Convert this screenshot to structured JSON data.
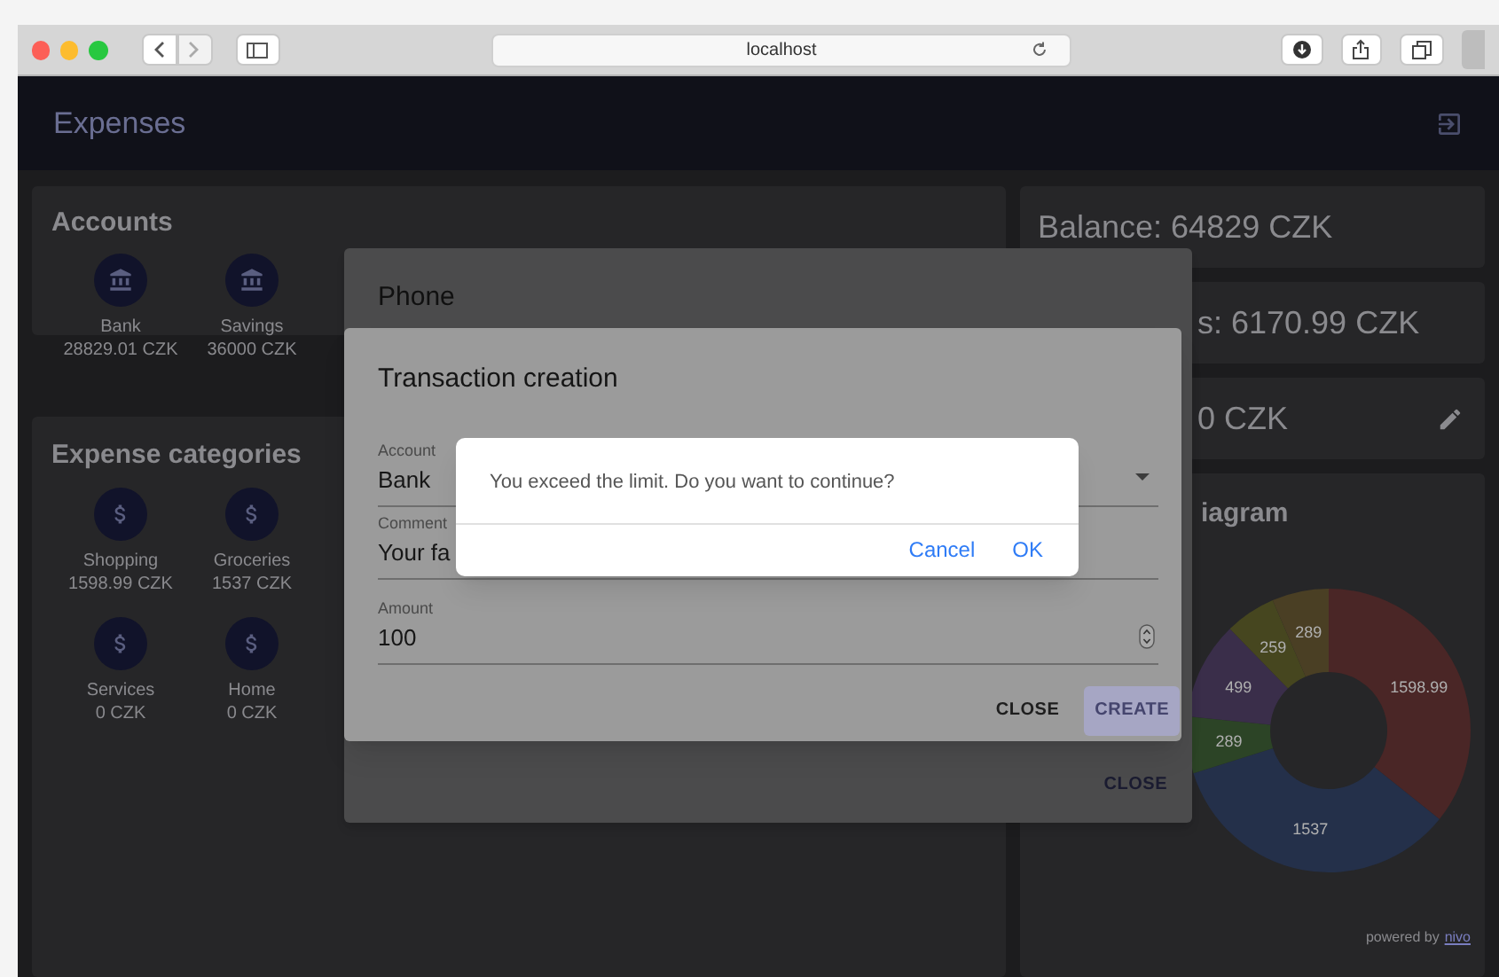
{
  "browser": {
    "address": "localhost"
  },
  "app": {
    "title": "Expenses",
    "accounts": {
      "title": "Accounts",
      "items": [
        {
          "name": "Bank",
          "amount": "28829.01 CZK"
        },
        {
          "name": "Savings",
          "amount": "36000 CZK"
        }
      ]
    },
    "categories": {
      "title": "Expense categories",
      "items": [
        {
          "name": "Shopping",
          "amount": "1598.99 CZK"
        },
        {
          "name": "Groceries",
          "amount": "1537 CZK"
        },
        {
          "name": "Services",
          "amount": "0 CZK"
        },
        {
          "name": "Home",
          "amount": "0 CZK"
        }
      ]
    },
    "summary": [
      {
        "text": "Balance: 64829 CZK",
        "editable": false
      },
      {
        "text": "s: 6170.99 CZK",
        "editable": false
      },
      {
        "text": "0 CZK",
        "editable": true
      }
    ],
    "diagram": {
      "title": "iagram",
      "credit": "powered by",
      "credit_link": "nivo",
      "chart_data": {
        "type": "donut",
        "values": [
          1598.99,
          1537,
          289,
          499,
          259,
          289
        ],
        "data_labels": true,
        "colors": [
          "#4a2626",
          "#24304a",
          "#2c4426",
          "#3a2e4a",
          "#46461f",
          "#4a3f24"
        ]
      }
    }
  },
  "phone_dialog": {
    "title": "Phone",
    "button": "CLOSE"
  },
  "transaction_dialog": {
    "title": "Transaction creation",
    "fields": [
      {
        "kind": "select",
        "label": "Account",
        "value": "Bank"
      },
      {
        "kind": "text",
        "label": "Comment",
        "value": "Your fa"
      },
      {
        "kind": "number",
        "label": "Amount",
        "value": "100"
      }
    ],
    "buttons": [
      {
        "kind": "text",
        "label": "CLOSE"
      },
      {
        "kind": "contained",
        "label": "CREATE"
      }
    ]
  },
  "confirm": {
    "message": "You exceed the limit. Do you want to continue?",
    "buttons": [
      "Cancel",
      "OK"
    ]
  }
}
